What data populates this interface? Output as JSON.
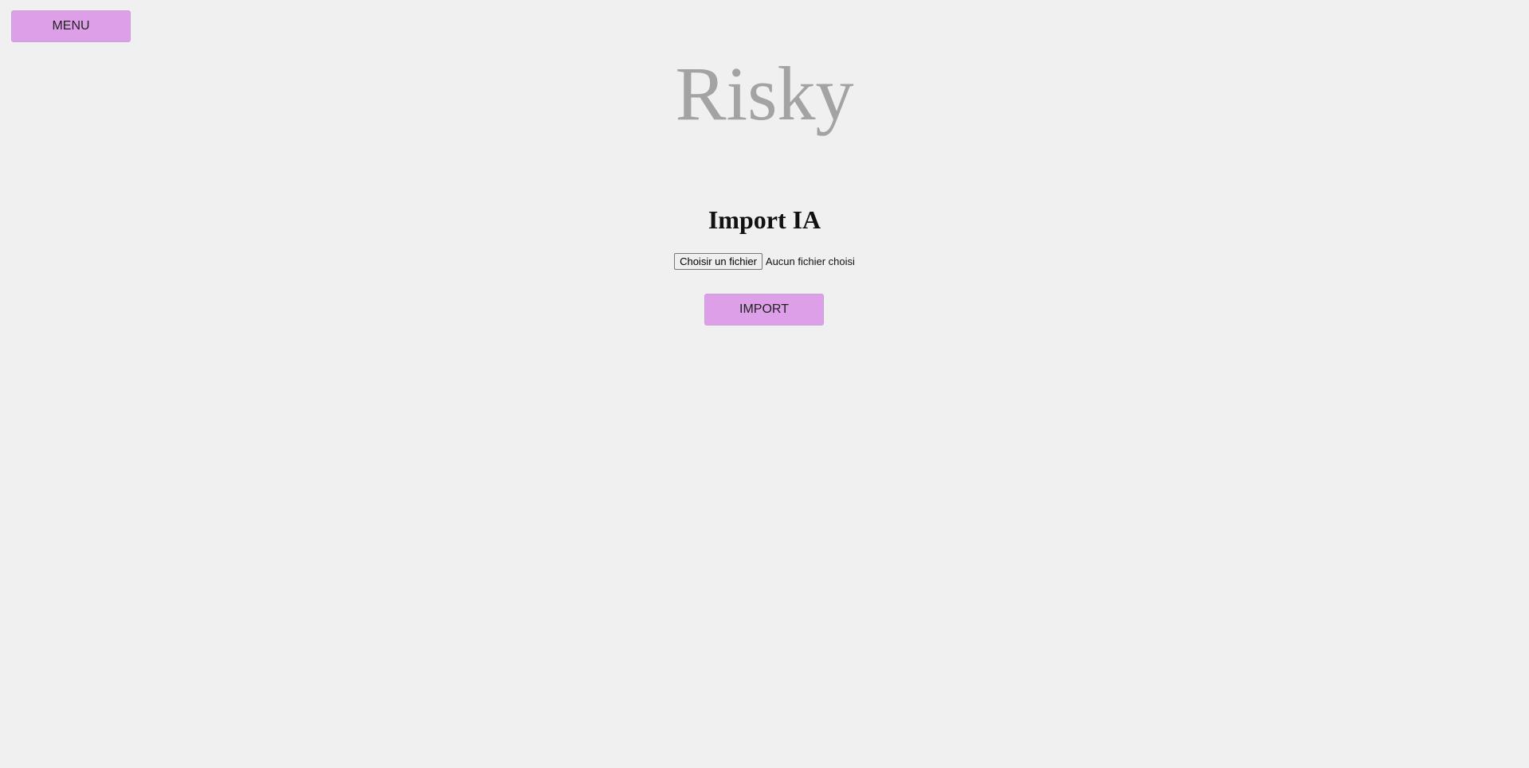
{
  "header": {
    "menu_label": "MENU",
    "logo_text": "Risky"
  },
  "main": {
    "title": "Import IA",
    "file_input": {
      "button_label": "Choisir un fichier",
      "status_text": "Aucun fichier choisi"
    },
    "import_label": "IMPORT"
  },
  "colors": {
    "background": "#f0f0f0",
    "button_accent": "#dda0e8",
    "logo": "#a3a3a3"
  }
}
